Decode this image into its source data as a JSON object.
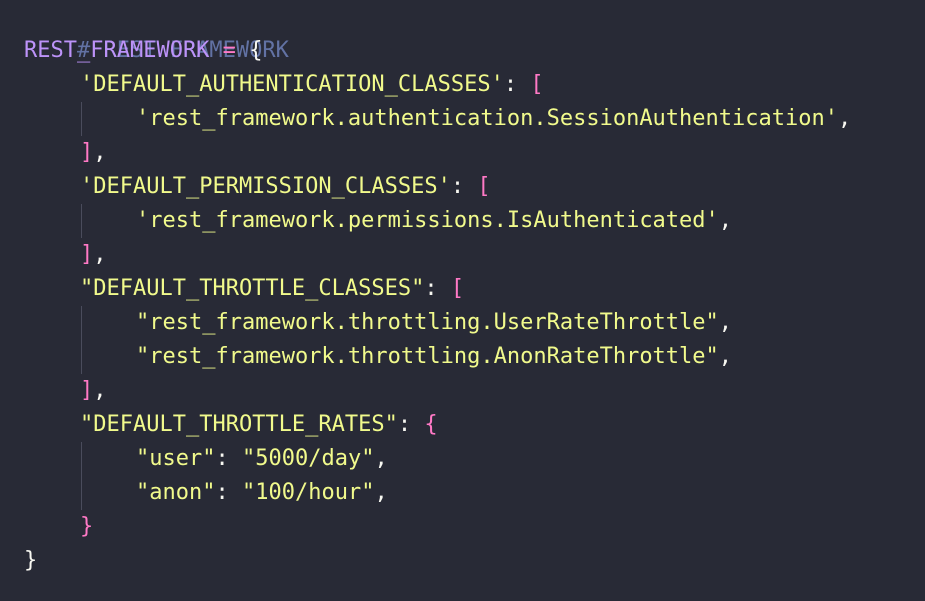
{
  "code": {
    "comment": "# REST FRAMEWORK",
    "var_name": "REST_FRAMEWORK",
    "assign": " = ",
    "open_brace": "{",
    "close_brace": "}",
    "auth_key": "'DEFAULT_AUTHENTICATION_CLASSES'",
    "auth_val": "'rest_framework.authentication.SessionAuthentication'",
    "perm_key": "'DEFAULT_PERMISSION_CLASSES'",
    "perm_val": "'rest_framework.permissions.IsAuthenticated'",
    "throttle_key": "\"DEFAULT_THROTTLE_CLASSES\"",
    "throttle_val_1": "\"rest_framework.throttling.UserRateThrottle\"",
    "throttle_val_2": "\"rest_framework.throttling.AnonRateThrottle\"",
    "rates_key": "\"DEFAULT_THROTTLE_RATES\"",
    "rate_user_key": "\"user\"",
    "rate_user_val": "\"5000/day\"",
    "rate_anon_key": "\"anon\"",
    "rate_anon_val": "\"100/hour\"",
    "colon": ": ",
    "comma": ",",
    "open_bracket": "[",
    "close_bracket": "]",
    "inner_open_brace": "{",
    "inner_close_brace": "}"
  },
  "colors": {
    "background": "#282a36",
    "comment": "#6272a4",
    "variable": "#bd93f9",
    "operator": "#ff79c6",
    "string": "#f1fa8c",
    "text": "#f8f8f2"
  }
}
